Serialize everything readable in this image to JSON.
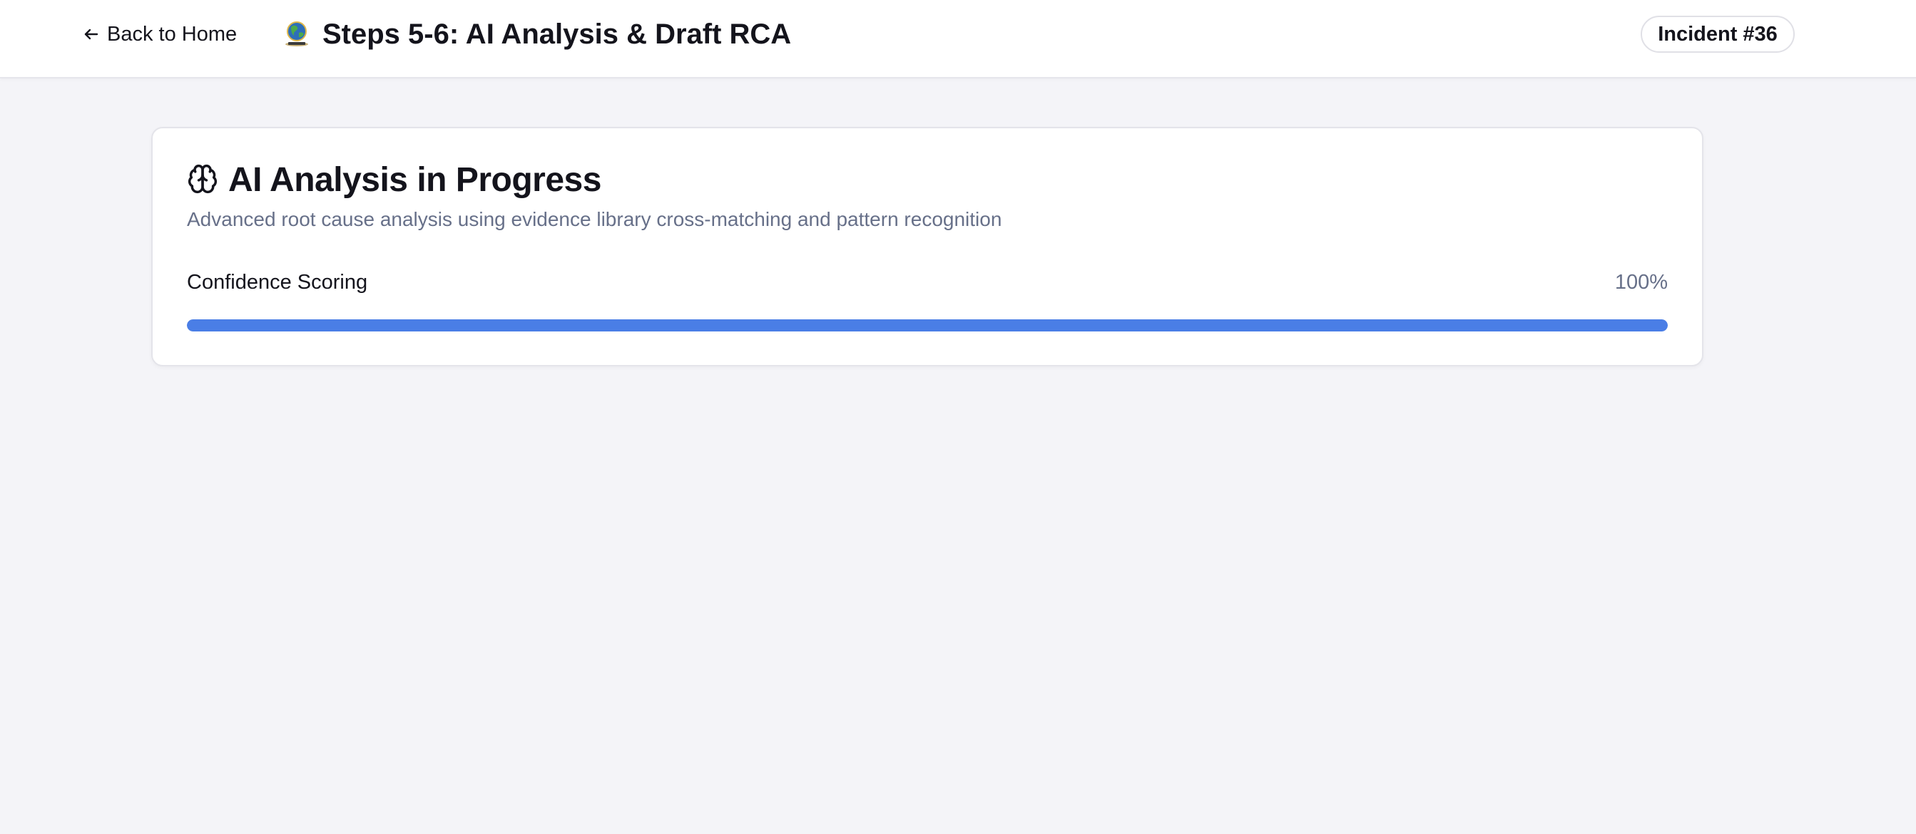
{
  "header": {
    "back_label": "Back to Home",
    "title": "Steps 5-6: AI Analysis & Draft RCA",
    "incident_badge": "Incident #36",
    "back_icon": "arrow-left-icon",
    "logo_icon": "globe-logo-icon"
  },
  "analysis": {
    "icon": "brain-icon",
    "title": "AI Analysis in Progress",
    "subtitle": "Advanced root cause analysis using evidence library cross-matching and pattern recognition",
    "progress": {
      "label": "Confidence Scoring",
      "value_text": "100%",
      "fraction": 1.0
    }
  },
  "colors": {
    "accent": "#4a7ee6",
    "background": "#f4f4f8",
    "muted_text": "#677089"
  }
}
